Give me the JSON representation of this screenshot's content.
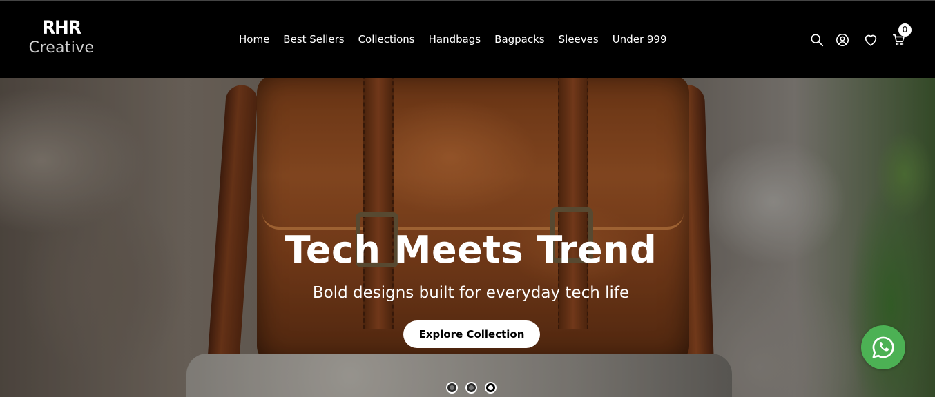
{
  "brand": {
    "line1": "RHR",
    "line2": "Creative"
  },
  "nav": {
    "items": [
      {
        "label": "Home"
      },
      {
        "label": "Best Sellers"
      },
      {
        "label": "Collections"
      },
      {
        "label": "Handbags"
      },
      {
        "label": "Bagpacks"
      },
      {
        "label": "Sleeves"
      },
      {
        "label": "Under 999"
      }
    ]
  },
  "header_icons": [
    "search-icon",
    "account-icon",
    "heart-icon",
    "cart-icon"
  ],
  "cart": {
    "count": "0"
  },
  "hero": {
    "title": "Tech Meets Trend",
    "subtitle": "Bold designs built for everyday tech life",
    "cta_label": "Explore Collection",
    "slides_total": 3,
    "active_slide": 3
  },
  "colors": {
    "header_bg": "#000000",
    "text_primary": "#ffffff",
    "whatsapp_green": "#4cb154"
  },
  "floating": {
    "icon": "whatsapp-icon"
  }
}
